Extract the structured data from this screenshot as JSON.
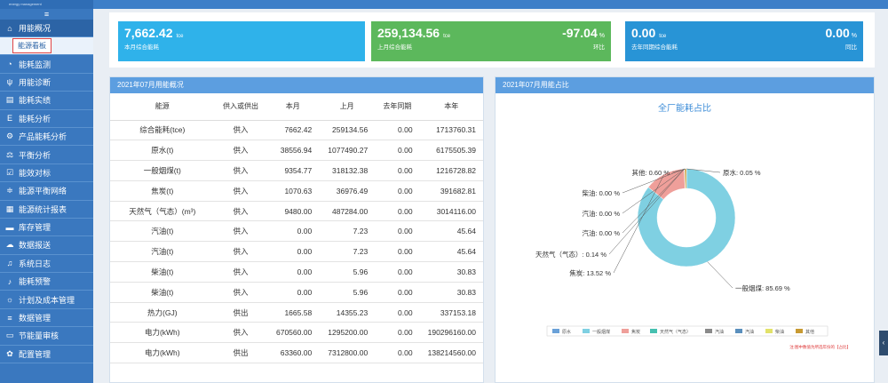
{
  "app": {
    "logo_text": "energy management"
  },
  "sidebar": {
    "toggle": "≡",
    "items": [
      {
        "icon": "⌂",
        "label": "用能概况"
      },
      {
        "icon": "◔",
        "label": "能耗监测"
      },
      {
        "icon": "ψ",
        "label": "用能诊断"
      },
      {
        "icon": "▤",
        "label": "能耗实绩"
      },
      {
        "icon": "E",
        "label": "能耗分析"
      },
      {
        "icon": "⚙",
        "label": "产品能耗分析"
      },
      {
        "icon": "⚖",
        "label": "平衡分析"
      },
      {
        "icon": "☑",
        "label": "能效对标"
      },
      {
        "icon": "≑",
        "label": "能源平衡网络"
      },
      {
        "icon": "▦",
        "label": "能源统计报表"
      },
      {
        "icon": "▬",
        "label": "库存管理"
      },
      {
        "icon": "☁",
        "label": "数据报送"
      },
      {
        "icon": "♫",
        "label": "系统日志"
      },
      {
        "icon": "♪",
        "label": "能耗预警"
      },
      {
        "icon": "☼",
        "label": "计划及成本管理"
      },
      {
        "icon": "≡",
        "label": "数据管理"
      },
      {
        "icon": "▭",
        "label": "节能量审核"
      },
      {
        "icon": "✿",
        "label": "配置管理"
      }
    ],
    "sub_item": "能源看板"
  },
  "kpis": [
    {
      "value": "7,662.42",
      "unit": "tce",
      "label": "本月综合能耗",
      "color": "#2fb2ea"
    },
    {
      "value": "259,134.56",
      "unit": "tce",
      "label": "上月综合能耗",
      "right_value": "-97.04",
      "right_unit": "%",
      "right_label": "环比",
      "color": "#5cb85c"
    },
    {
      "value": "0.00",
      "unit": "tce",
      "label": "去年同期综合能耗",
      "right_value": "0.00",
      "right_unit": "%",
      "right_label": "同比",
      "color": "#2894d6"
    }
  ],
  "table_panel": {
    "title": "2021年07月用能概况",
    "headers": [
      "能源",
      "供入或供出",
      "本月",
      "上月",
      "去年同期",
      "本年"
    ],
    "rows": [
      [
        "综合能耗(tce)",
        "供入",
        "7662.42",
        "259134.56",
        "0.00",
        "1713760.31"
      ],
      [
        "原水(t)",
        "供入",
        "38556.94",
        "1077490.27",
        "0.00",
        "6175505.39"
      ],
      [
        "一般烟煤(t)",
        "供入",
        "9354.77",
        "318132.38",
        "0.00",
        "1216728.82"
      ],
      [
        "焦炭(t)",
        "供入",
        "1070.63",
        "36976.49",
        "0.00",
        "391682.81"
      ],
      [
        "天然气（气态）(m³)",
        "供入",
        "9480.00",
        "487284.00",
        "0.00",
        "3014116.00"
      ],
      [
        "汽油(t)",
        "供入",
        "0.00",
        "7.23",
        "0.00",
        "45.64"
      ],
      [
        "汽油(t)",
        "供入",
        "0.00",
        "7.23",
        "0.00",
        "45.64"
      ],
      [
        "柴油(t)",
        "供入",
        "0.00",
        "5.96",
        "0.00",
        "30.83"
      ],
      [
        "柴油(t)",
        "供入",
        "0.00",
        "5.96",
        "0.00",
        "30.83"
      ],
      [
        "热力(GJ)",
        "供出",
        "1665.58",
        "14355.23",
        "0.00",
        "337153.18"
      ],
      [
        "电力(kWh)",
        "供入",
        "670560.00",
        "1295200.00",
        "0.00",
        "190296160.00"
      ],
      [
        "电力(kWh)",
        "供出",
        "63360.00",
        "7312800.00",
        "0.00",
        "138214560.00"
      ]
    ]
  },
  "chart_panel": {
    "title": "2021年07月用能占比",
    "footnote": "注:图中数值为所选年份的【占比】"
  },
  "chart_data": {
    "type": "pie",
    "title": "全厂能耗占比",
    "series": [
      {
        "name": "原水",
        "value": 0.05,
        "color": "#6aa1d8",
        "label": "原水: 0.05 %"
      },
      {
        "name": "一般烟煤",
        "value": 85.69,
        "color": "#7fd0e2",
        "label": "一般烟煤: 85.69 %"
      },
      {
        "name": "焦炭",
        "value": 13.52,
        "color": "#ef9f9a",
        "label": "焦炭: 13.52 %"
      },
      {
        "name": "天然气（气态）",
        "value": 0.14,
        "color": "#46c0b0",
        "label": "天然气（气态）: 0.14 %"
      },
      {
        "name": "汽油",
        "value": 0.0,
        "color": "#8a8a8a",
        "label": "汽油: 0.00 %"
      },
      {
        "name": "汽油",
        "value": 0.0,
        "color": "#5a8fbd",
        "label": "汽油: 0.00 %"
      },
      {
        "name": "柴油",
        "value": 0.0,
        "color": "#e2e26a",
        "label": "柴油: 0.00 %"
      },
      {
        "name": "其他",
        "value": 0.6,
        "color": "#c89a32",
        "label": "其他: 0.60 %"
      }
    ],
    "legend": [
      "原水",
      "一般烟煤",
      "焦炭",
      "天然气（气态）",
      "汽油",
      "汽油",
      "柴油",
      "其他"
    ]
  }
}
